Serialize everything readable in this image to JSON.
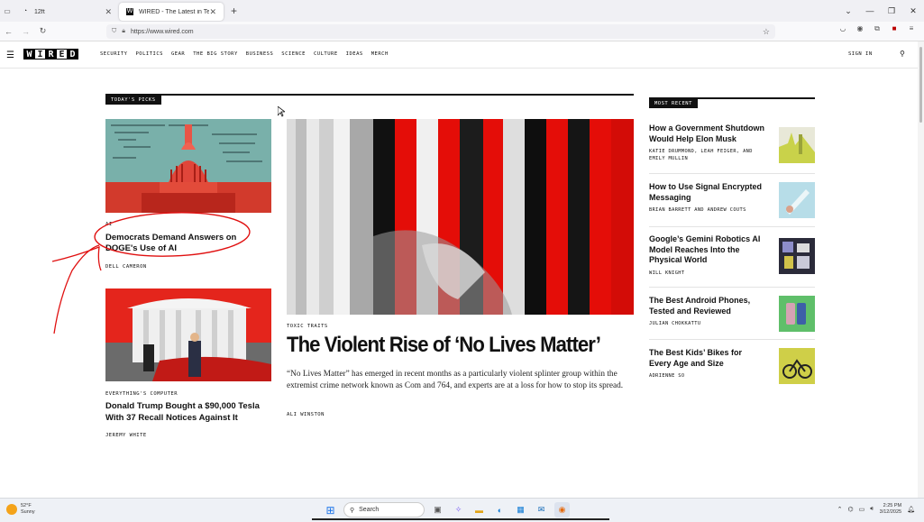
{
  "browser": {
    "tabs": [
      {
        "title": "12ft",
        "active": false
      },
      {
        "title": "WIRED - The Latest in Technolo",
        "active": true
      }
    ],
    "url": "https://www.wired.com"
  },
  "site": {
    "logo_letters": [
      "W",
      "I",
      "R",
      "E",
      "D"
    ],
    "nav": [
      "SECURITY",
      "POLITICS",
      "GEAR",
      "THE BIG STORY",
      "BUSINESS",
      "SCIENCE",
      "CULTURE",
      "IDEAS",
      "MERCH"
    ],
    "sign_in": "SIGN IN"
  },
  "todays_picks": {
    "label": "TODAY'S PICKS",
    "left_story_1": {
      "kicker": "AI",
      "headline": "Democrats Demand Answers on DOGE's Use of AI",
      "byline": "DELL CAMERON"
    },
    "left_story_2": {
      "kicker": "EVERYTHING'S COMPUTER",
      "headline": "Donald Trump Bought a $90,000 Tesla With 37 Recall Notices Against It",
      "byline": "JEREMY WHITE"
    },
    "main_story": {
      "kicker": "TOXIC TRAITS",
      "headline": "The Violent Rise of ‘No Lives Matter’",
      "dek": "“No Lives Matter” has emerged in recent months as a particularly violent splinter group within the extremist crime network known as Com and 764, and experts are at a loss for how to stop its spread.",
      "byline": "ALI WINSTON"
    }
  },
  "most_recent": {
    "label": "MOST RECENT",
    "items": [
      {
        "headline": "How a Government Shutdown Would Help Elon Musk",
        "byline": "KATIE DRUMMOND, LEAH FEIGER, AND EMILY MULLIN"
      },
      {
        "headline": "How to Use Signal Encrypted Messaging",
        "byline": "BRIAN BARRETT AND ANDREW COUTS"
      },
      {
        "headline": "Google’s Gemini Robotics AI Model Reaches Into the Physical World",
        "byline": "WILL KNIGHT"
      },
      {
        "headline": "The Best Android Phones, Tested and Reviewed",
        "byline": "JULIAN CHOKKATTU"
      },
      {
        "headline": "The Best Kids’ Bikes for Every Age and Size",
        "byline": "ADRIENNE SO"
      }
    ]
  },
  "taskbar": {
    "weather_temp": "52°F",
    "weather_desc": "Sunny",
    "search_label": "Search",
    "time": "2:25 PM",
    "date": "3/12/2025"
  },
  "colors": {
    "wired_red": "#e10600",
    "annotation_red": "#e01010",
    "black": "#111111"
  }
}
